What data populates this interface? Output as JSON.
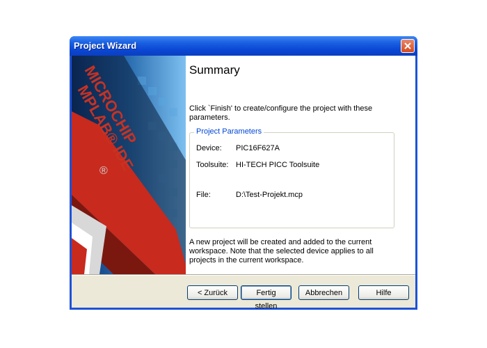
{
  "window": {
    "title": "Project Wizard"
  },
  "banner": {
    "brand_top": "MICROCHIP",
    "brand_bottom": "MPLAB® IDE",
    "registered": "®"
  },
  "summary": {
    "heading": "Summary",
    "description": "Click `Finish' to create/configure the project with these parameters.",
    "group_title": "Project Parameters",
    "params": [
      {
        "label": "Device:",
        "value": "PIC16F627A"
      },
      {
        "label": "Toolsuite:",
        "value": "HI-TECH PICC Toolsuite"
      },
      {
        "label": "File:",
        "value": "D:\\Test-Projekt.mcp"
      }
    ],
    "footnote": "A new project will be created and added to the current workspace.  Note that the selected device applies to all projects in the current workspace."
  },
  "buttons": {
    "back": "< Zurück",
    "finish": "Fertig stellen",
    "cancel": "Abbrechen",
    "help": "Hilfe"
  },
  "colors": {
    "titlebar": "#0a47d4",
    "close": "#d44a1e",
    "group_title": "#0046d5",
    "dialog_bg": "#ece9d8"
  }
}
